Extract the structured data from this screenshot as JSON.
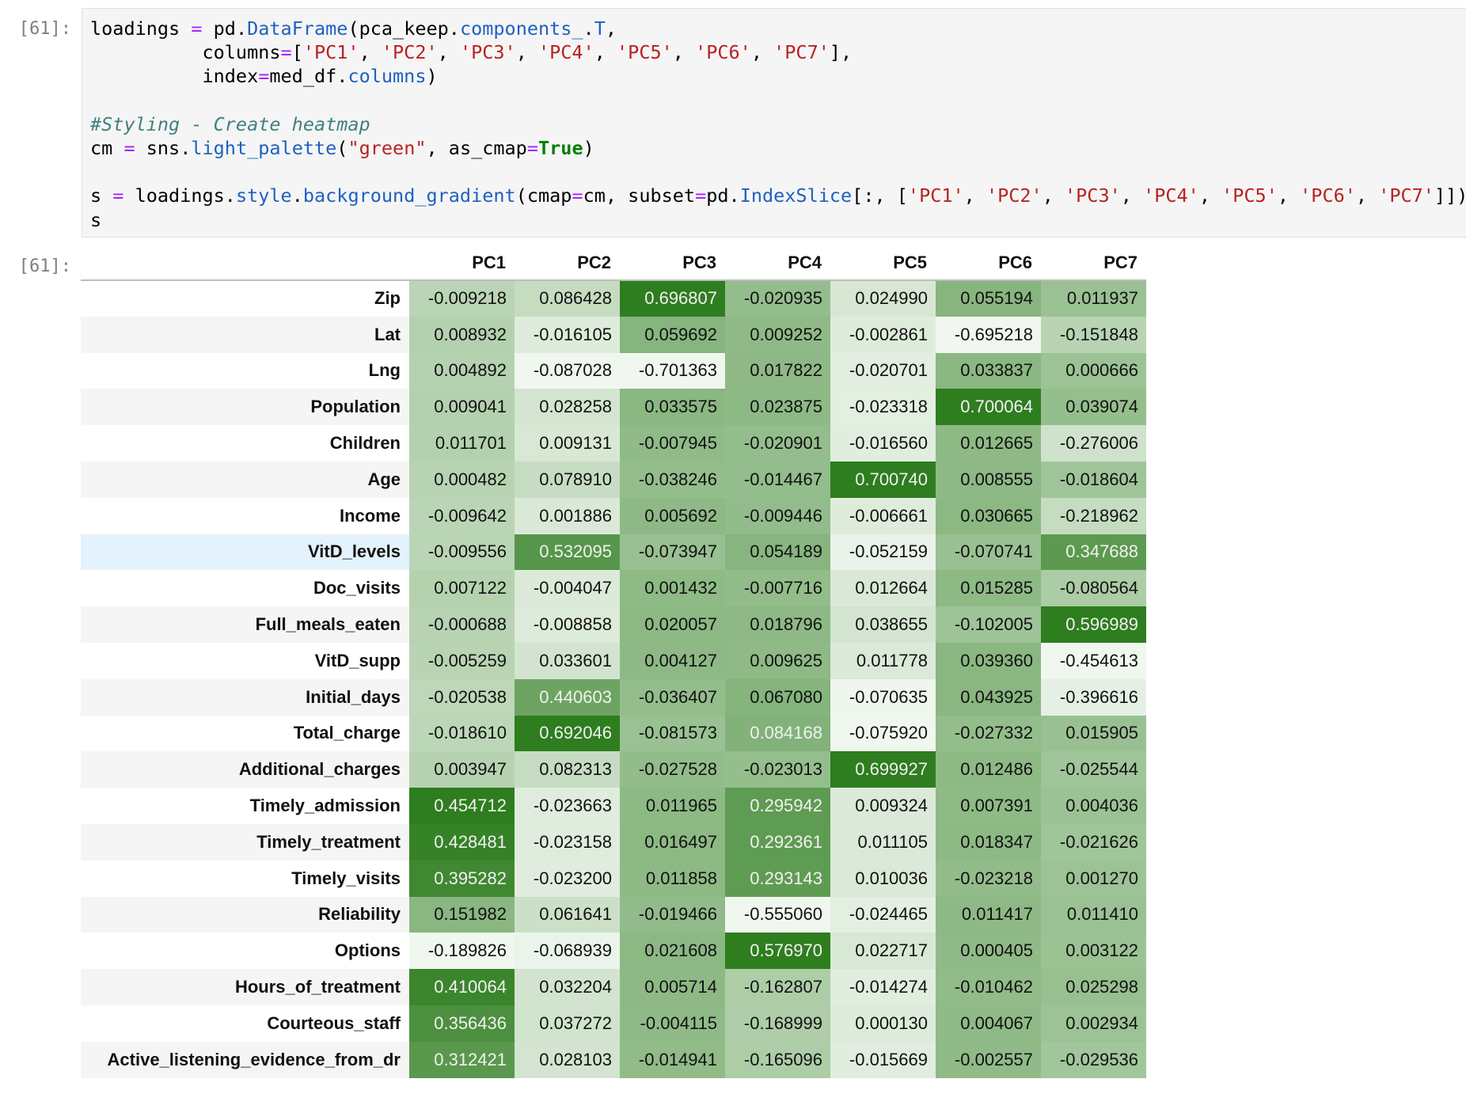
{
  "cells": {
    "input_prompt": "[61]:",
    "output_prompt": "[61]:"
  },
  "code_lines": [
    [
      [
        "p",
        "loadings "
      ],
      [
        "op",
        "="
      ],
      [
        "p",
        " pd"
      ],
      [
        "p",
        "."
      ],
      [
        "attr",
        "DataFrame"
      ],
      [
        "p",
        "(pca_keep"
      ],
      [
        "p",
        "."
      ],
      [
        "attr",
        "components_"
      ],
      [
        "p",
        "."
      ],
      [
        "attr",
        "T"
      ],
      [
        "p",
        ","
      ]
    ],
    [
      [
        "p",
        "          columns"
      ],
      [
        "op",
        "="
      ],
      [
        "p",
        "["
      ],
      [
        "str",
        "'PC1'"
      ],
      [
        "p",
        ", "
      ],
      [
        "str",
        "'PC2'"
      ],
      [
        "p",
        ", "
      ],
      [
        "str",
        "'PC3'"
      ],
      [
        "p",
        ", "
      ],
      [
        "str",
        "'PC4'"
      ],
      [
        "p",
        ", "
      ],
      [
        "str",
        "'PC5'"
      ],
      [
        "p",
        ", "
      ],
      [
        "str",
        "'PC6'"
      ],
      [
        "p",
        ", "
      ],
      [
        "str",
        "'PC7'"
      ],
      [
        "p",
        "],"
      ]
    ],
    [
      [
        "p",
        "          index"
      ],
      [
        "op",
        "="
      ],
      [
        "p",
        "med_df"
      ],
      [
        "p",
        "."
      ],
      [
        "attr",
        "columns"
      ],
      [
        "p",
        ")"
      ]
    ],
    [],
    [
      [
        "cmt",
        "#Styling - Create heatmap"
      ]
    ],
    [
      [
        "p",
        "cm "
      ],
      [
        "op",
        "="
      ],
      [
        "p",
        " sns"
      ],
      [
        "p",
        "."
      ],
      [
        "attr",
        "light_palette"
      ],
      [
        "p",
        "("
      ],
      [
        "str",
        "\"green\""
      ],
      [
        "p",
        ", as_cmap"
      ],
      [
        "op",
        "="
      ],
      [
        "kw",
        "True"
      ],
      [
        "p",
        ")"
      ]
    ],
    [],
    [
      [
        "p",
        "s "
      ],
      [
        "op",
        "="
      ],
      [
        "p",
        " loadings"
      ],
      [
        "p",
        "."
      ],
      [
        "attr",
        "style"
      ],
      [
        "p",
        "."
      ],
      [
        "attr",
        "background_gradient"
      ],
      [
        "p",
        "(cmap"
      ],
      [
        "op",
        "="
      ],
      [
        "p",
        "cm, subset"
      ],
      [
        "op",
        "="
      ],
      [
        "p",
        "pd"
      ],
      [
        "p",
        "."
      ],
      [
        "attr",
        "IndexSlice"
      ],
      [
        "p",
        "[:, ["
      ],
      [
        "str",
        "'PC1'"
      ],
      [
        "p",
        ", "
      ],
      [
        "str",
        "'PC2'"
      ],
      [
        "p",
        ", "
      ],
      [
        "str",
        "'PC3'"
      ],
      [
        "p",
        ", "
      ],
      [
        "str",
        "'PC4'"
      ],
      [
        "p",
        ", "
      ],
      [
        "str",
        "'PC5'"
      ],
      [
        "p",
        ", "
      ],
      [
        "str",
        "'PC6'"
      ],
      [
        "p",
        ", "
      ],
      [
        "str",
        "'PC7'"
      ],
      [
        "p",
        "]])"
      ]
    ],
    [
      [
        "p",
        "s"
      ]
    ]
  ],
  "table": {
    "columns": [
      "PC1",
      "PC2",
      "PC3",
      "PC4",
      "PC5",
      "PC6",
      "PC7"
    ],
    "highlighted_row": "VitD_levels",
    "cmap_colors": [
      "#f0f7ef",
      "#2e7d1f"
    ],
    "rows": [
      {
        "label": "Zip",
        "values": [
          "-0.009218",
          "0.086428",
          "0.696807",
          "-0.020935",
          "0.024990",
          "0.055194",
          "0.011937"
        ]
      },
      {
        "label": "Lat",
        "values": [
          "0.008932",
          "-0.016105",
          "0.059692",
          "0.009252",
          "-0.002861",
          "-0.695218",
          "-0.151848"
        ]
      },
      {
        "label": "Lng",
        "values": [
          "0.004892",
          "-0.087028",
          "-0.701363",
          "0.017822",
          "-0.020701",
          "0.033837",
          "0.000666"
        ]
      },
      {
        "label": "Population",
        "values": [
          "0.009041",
          "0.028258",
          "0.033575",
          "0.023875",
          "-0.023318",
          "0.700064",
          "0.039074"
        ]
      },
      {
        "label": "Children",
        "values": [
          "0.011701",
          "0.009131",
          "-0.007945",
          "-0.020901",
          "-0.016560",
          "0.012665",
          "-0.276006"
        ]
      },
      {
        "label": "Age",
        "values": [
          "0.000482",
          "0.078910",
          "-0.038246",
          "-0.014467",
          "0.700740",
          "0.008555",
          "-0.018604"
        ]
      },
      {
        "label": "Income",
        "values": [
          "-0.009642",
          "0.001886",
          "0.005692",
          "-0.009446",
          "-0.006661",
          "0.030665",
          "-0.218962"
        ]
      },
      {
        "label": "VitD_levels",
        "values": [
          "-0.009556",
          "0.532095",
          "-0.073947",
          "0.054189",
          "-0.052159",
          "-0.070741",
          "0.347688"
        ]
      },
      {
        "label": "Doc_visits",
        "values": [
          "0.007122",
          "-0.004047",
          "0.001432",
          "-0.007716",
          "0.012664",
          "0.015285",
          "-0.080564"
        ]
      },
      {
        "label": "Full_meals_eaten",
        "values": [
          "-0.000688",
          "-0.008858",
          "0.020057",
          "0.018796",
          "0.038655",
          "-0.102005",
          "0.596989"
        ]
      },
      {
        "label": "VitD_supp",
        "values": [
          "-0.005259",
          "0.033601",
          "0.004127",
          "0.009625",
          "0.011778",
          "0.039360",
          "-0.454613"
        ]
      },
      {
        "label": "Initial_days",
        "values": [
          "-0.020538",
          "0.440603",
          "-0.036407",
          "0.067080",
          "-0.070635",
          "0.043925",
          "-0.396616"
        ]
      },
      {
        "label": "Total_charge",
        "values": [
          "-0.018610",
          "0.692046",
          "-0.081573",
          "0.084168",
          "-0.075920",
          "-0.027332",
          "0.015905"
        ]
      },
      {
        "label": "Additional_charges",
        "values": [
          "0.003947",
          "0.082313",
          "-0.027528",
          "-0.023013",
          "0.699927",
          "0.012486",
          "-0.025544"
        ]
      },
      {
        "label": "Timely_admission",
        "values": [
          "0.454712",
          "-0.023663",
          "0.011965",
          "0.295942",
          "0.009324",
          "0.007391",
          "0.004036"
        ]
      },
      {
        "label": "Timely_treatment",
        "values": [
          "0.428481",
          "-0.023158",
          "0.016497",
          "0.292361",
          "0.011105",
          "0.018347",
          "-0.021626"
        ]
      },
      {
        "label": "Timely_visits",
        "values": [
          "0.395282",
          "-0.023200",
          "0.011858",
          "0.293143",
          "0.010036",
          "-0.023218",
          "0.001270"
        ]
      },
      {
        "label": "Reliability",
        "values": [
          "0.151982",
          "0.061641",
          "-0.019466",
          "-0.555060",
          "-0.024465",
          "0.011417",
          "0.011410"
        ]
      },
      {
        "label": "Options",
        "values": [
          "-0.189826",
          "-0.068939",
          "0.021608",
          "0.576970",
          "0.022717",
          "0.000405",
          "0.003122"
        ]
      },
      {
        "label": "Hours_of_treatment",
        "values": [
          "0.410064",
          "0.032204",
          "0.005714",
          "-0.162807",
          "-0.014274",
          "-0.010462",
          "0.025298"
        ]
      },
      {
        "label": "Courteous_staff",
        "values": [
          "0.356436",
          "0.037272",
          "-0.004115",
          "-0.168999",
          "0.000130",
          "0.004067",
          "0.002934"
        ]
      },
      {
        "label": "Active_listening_evidence_from_dr",
        "values": [
          "0.312421",
          "0.028103",
          "-0.014941",
          "-0.165096",
          "-0.015669",
          "-0.002557",
          "-0.029536"
        ]
      }
    ]
  }
}
